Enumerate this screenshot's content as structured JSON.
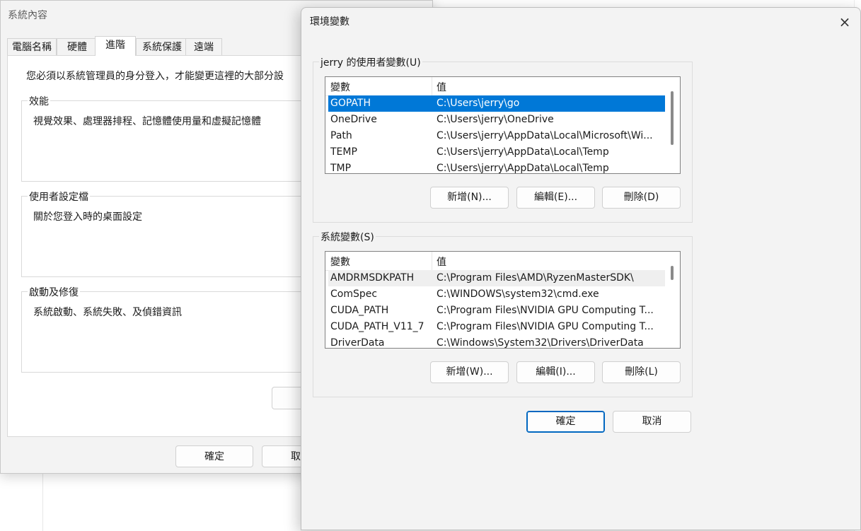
{
  "system_properties": {
    "title": "系統內容",
    "tabs": [
      "電腦名稱",
      "硬體",
      "進階",
      "系統保護",
      "遠端"
    ],
    "active_tab": "進階",
    "notice": "您必須以系統管理員的身分登入，才能變更這裡的大部分設",
    "groups": [
      {
        "legend": "效能",
        "description": "視覺效果、處理器排程、記憶體使用量和虛擬記憶體"
      },
      {
        "legend": "使用者設定檔",
        "description": "關於您登入時的桌面設定"
      },
      {
        "legend": "啟動及修復",
        "description": "系統啟動、系統失敗、及偵錯資訊"
      }
    ],
    "ok_label": "確定",
    "cancel_label_partial": "取"
  },
  "env_dialog": {
    "title": "環境變數",
    "close_icon": "×",
    "user_section": {
      "legend": "jerry 的使用者變數(U)",
      "col_name": "變數",
      "col_value": "值",
      "rows": [
        {
          "name": "GOPATH",
          "value": "C:\\Users\\jerry\\go"
        },
        {
          "name": "OneDrive",
          "value": "C:\\Users\\jerry\\OneDrive"
        },
        {
          "name": "Path",
          "value": "C:\\Users\\jerry\\AppData\\Local\\Microsoft\\Wi..."
        },
        {
          "name": "TEMP",
          "value": "C:\\Users\\jerry\\AppData\\Local\\Temp"
        },
        {
          "name": "TMP",
          "value": "C:\\Users\\jerry\\AppData\\Local\\Temp"
        }
      ],
      "selected_row": "GOPATH",
      "new_label": "新增(N)...",
      "edit_label": "編輯(E)...",
      "delete_label": "刪除(D)"
    },
    "system_section": {
      "legend": "系統變數(S)",
      "col_name": "變數",
      "col_value": "值",
      "rows": [
        {
          "name": "AMDRMSDKPATH",
          "value": "C:\\Program Files\\AMD\\RyzenMasterSDK\\"
        },
        {
          "name": "ComSpec",
          "value": "C:\\WINDOWS\\system32\\cmd.exe"
        },
        {
          "name": "CUDA_PATH",
          "value": "C:\\Program Files\\NVIDIA GPU Computing T..."
        },
        {
          "name": "CUDA_PATH_V11_7",
          "value": "C:\\Program Files\\NVIDIA GPU Computing T..."
        },
        {
          "name": "DriverData",
          "value": "C:\\Windows\\System32\\Drivers\\DriverData"
        }
      ],
      "highlighted_row": "AMDRMSDKPATH",
      "new_label": "新增(W)...",
      "edit_label": "編輯(I)...",
      "delete_label": "刪除(L)"
    },
    "ok_label": "確定",
    "cancel_label": "取消"
  },
  "colors": {
    "selection": "#0078d7",
    "primary_border": "#0067c0",
    "window_bg": "#f3f3f3"
  }
}
